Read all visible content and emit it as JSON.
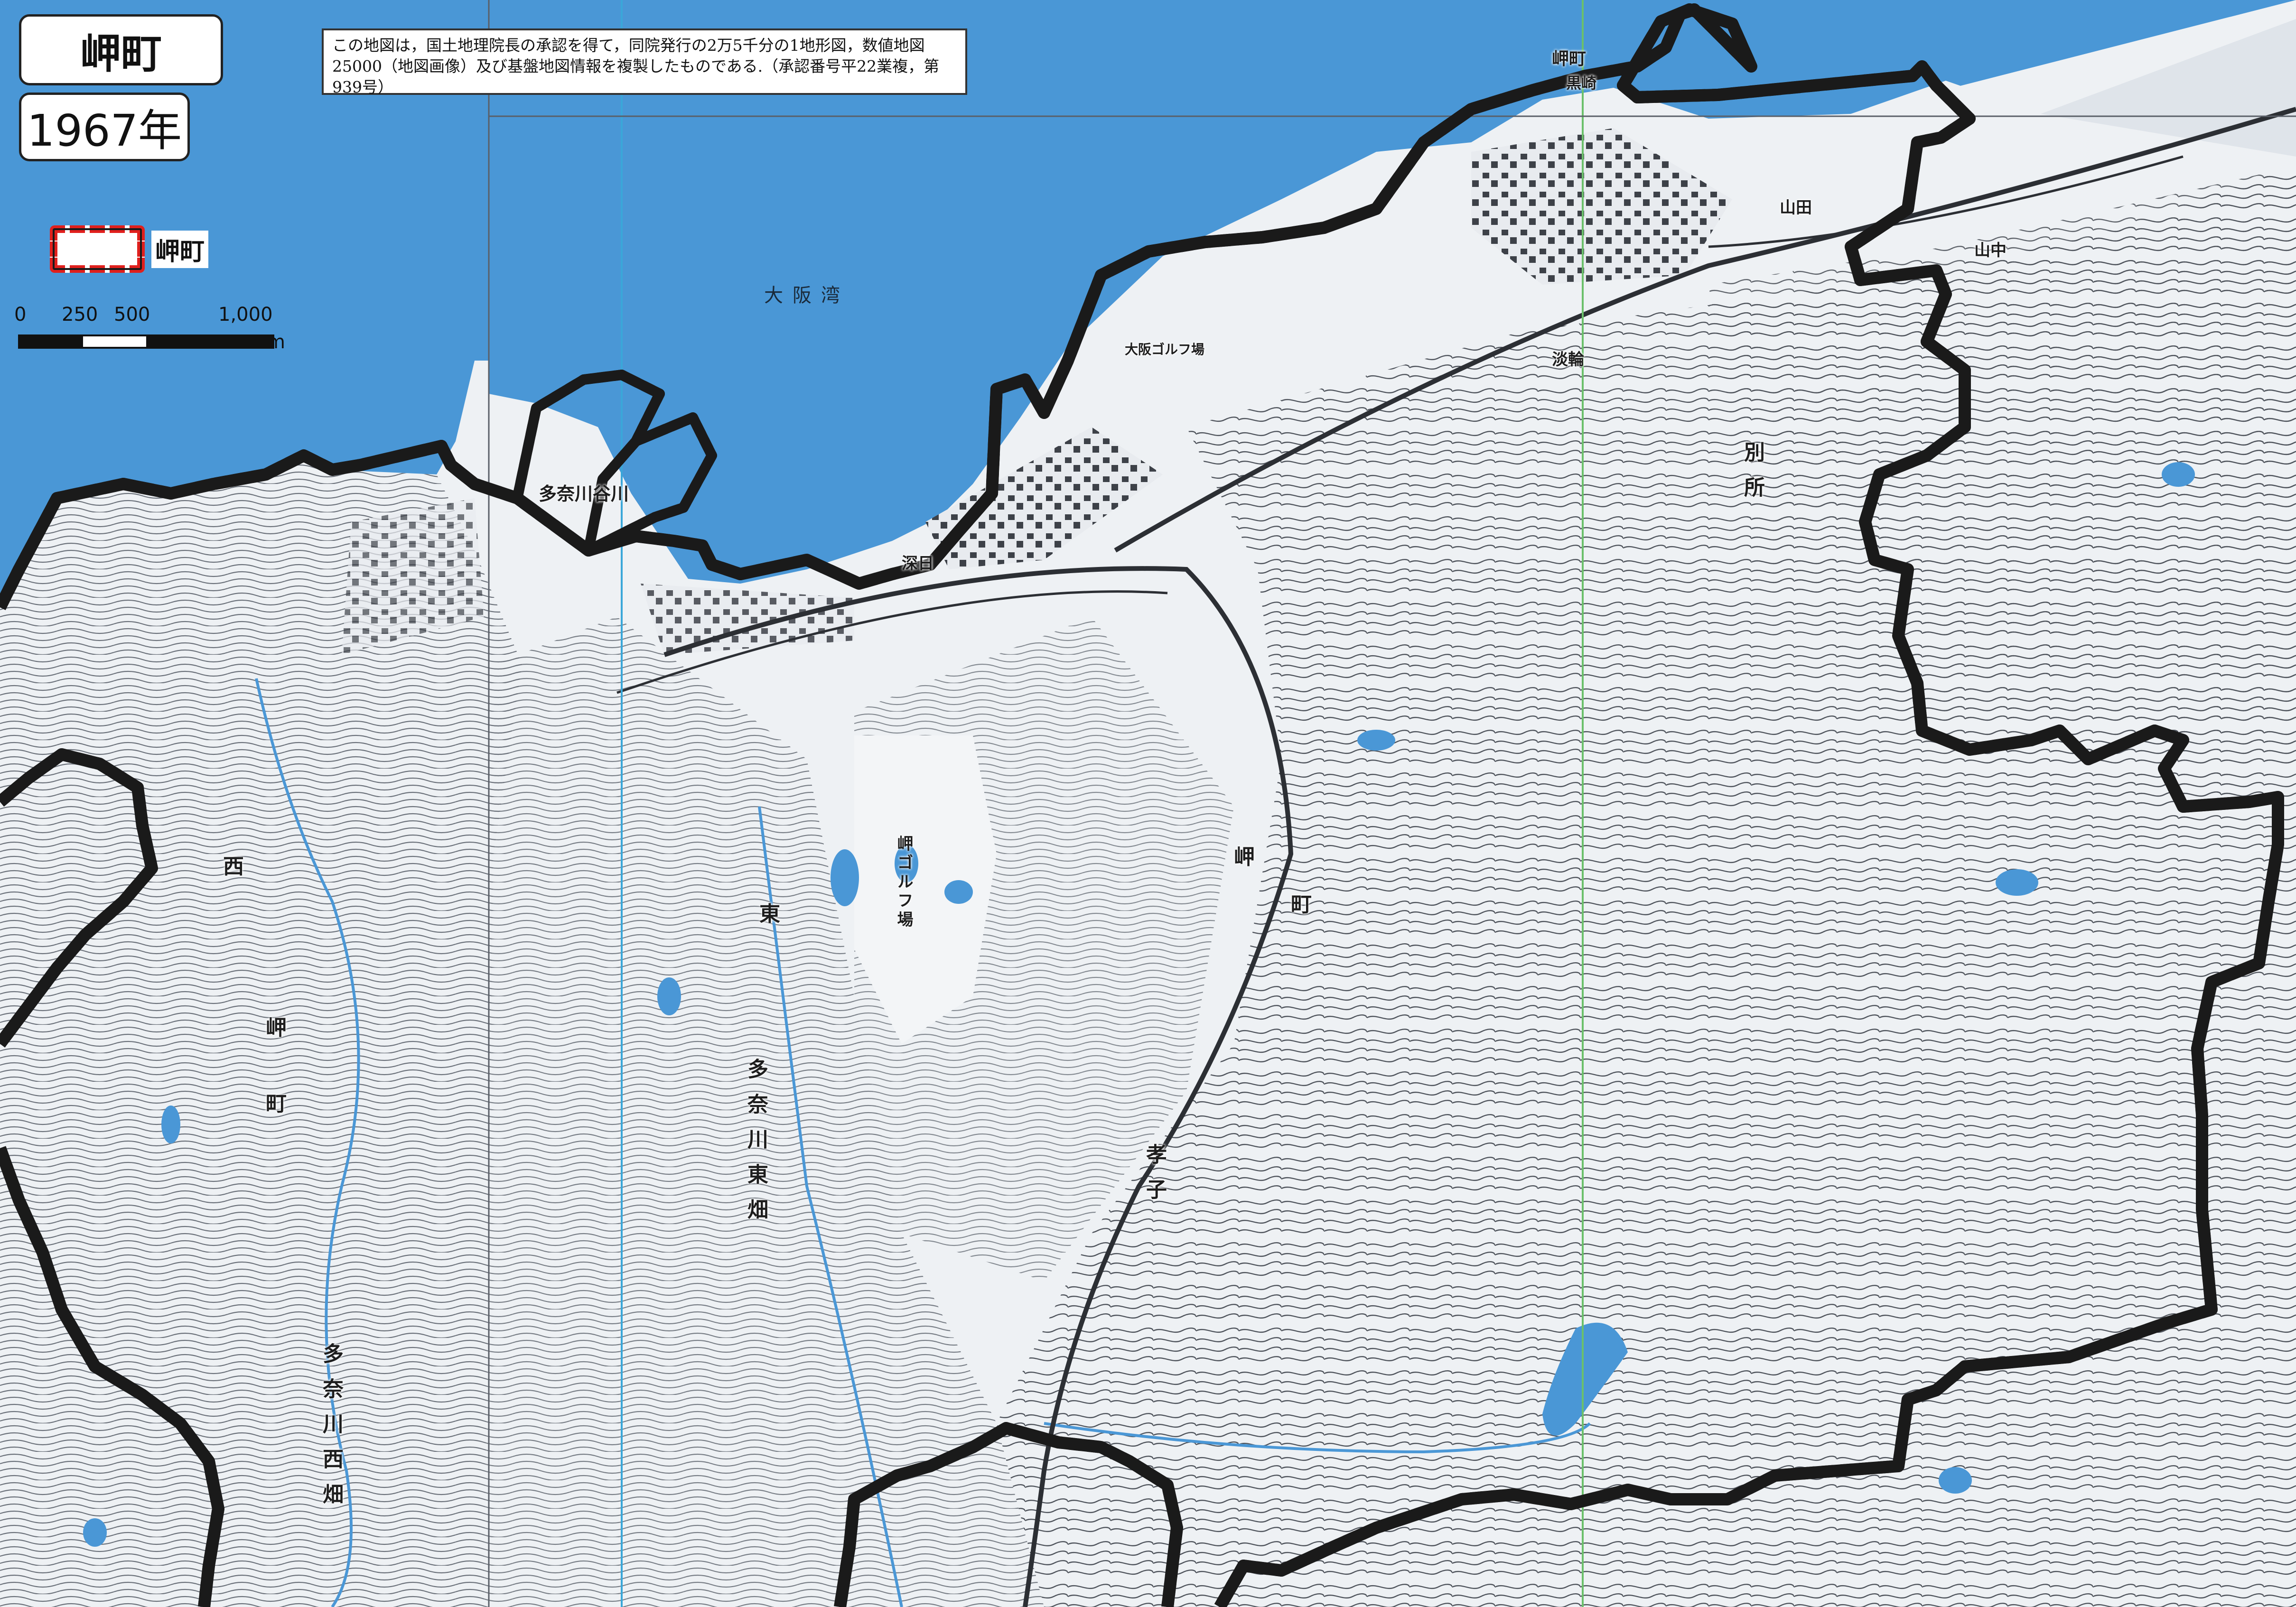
{
  "map": {
    "title": "岬町",
    "year": "1967年",
    "credit": "この地図は，国土地理院長の承認を得て，同院発行の2万5千分の1地形図，数値地図25000（地図画像）及び基盤地図情報を複製したものである.（承認番号平22業複，第939号）",
    "legend": {
      "label": "岬町",
      "boundary_color": "#e0201d"
    },
    "scale": {
      "ticks": [
        "0",
        "250",
        "500",
        "1,000"
      ],
      "unit": "m"
    },
    "sea_color": "#4a97d6",
    "land_color": "#eef1f4",
    "contour_color": "#5a5f68",
    "place_names": {
      "bay": "大阪湾",
      "misaki_kurosaki": "岬町",
      "kurosaki": "黒崎",
      "tanagawa_tani": "多奈川谷川",
      "tanagawa_higashi": "多奈川東畑",
      "tanagawa_nishi": "多奈川西畑",
      "misaki_center": "岬",
      "misaki_center2": "町",
      "kasai": "孝子",
      "misaki_west": "岬",
      "misaki_west2": "町",
      "nishi": "西",
      "higashi": "東",
      "tamagawa": "多奈川",
      "bessho": "別所",
      "yamada": "山田",
      "golf": "岬ゴルフ場",
      "osaka_golf": "大阪ゴルフ場",
      "tanowa": "淡輪",
      "fuke": "深日",
      "yamanaka": "山中"
    }
  }
}
